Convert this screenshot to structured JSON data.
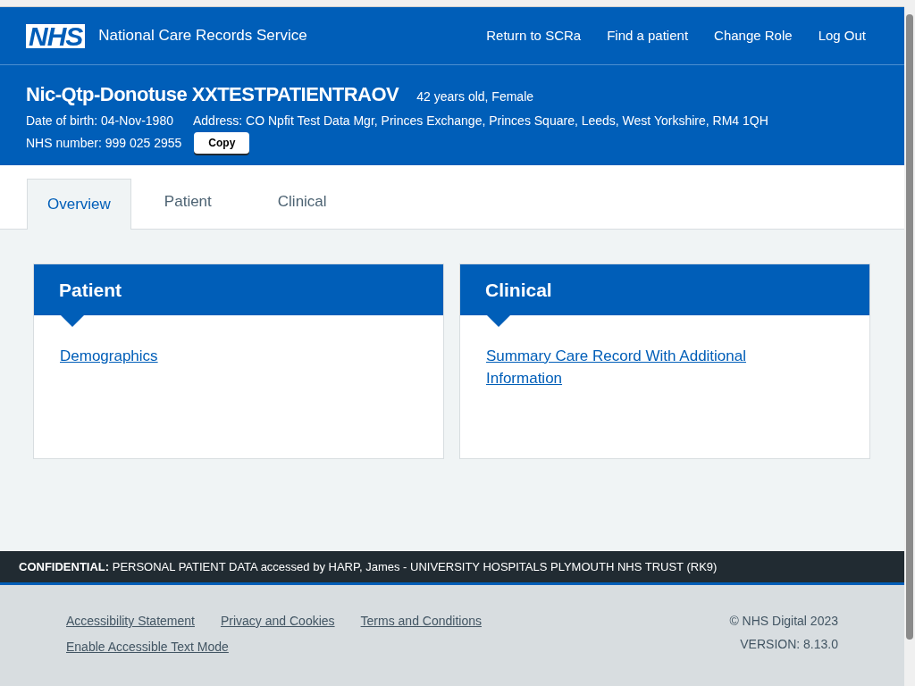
{
  "header": {
    "logo": "NHS",
    "service_name": "National Care Records Service",
    "nav_links": [
      "Return to SCRa",
      "Find a patient",
      "Change Role",
      "Log Out"
    ]
  },
  "patient_banner": {
    "name": "Nic-Qtp-Donotuse XXTESTPATIENTRAOV",
    "age_gender": "42 years old, Female",
    "date_of_birth": "Date of birth: 04-Nov-1980",
    "address": "Address: CO Npfit Test Data Mgr, Princes Exchange, Princes Square, Leeds, West Yorkshire, RM4 1QH",
    "nhs_number": "NHS number: 999 025 2955",
    "copy_button": "Copy"
  },
  "tabs": [
    {
      "label": "Overview",
      "selected": true
    },
    {
      "label": "Patient",
      "selected": false
    },
    {
      "label": "Clinical",
      "selected": false
    }
  ],
  "cards": [
    {
      "title": "Patient",
      "link": "Demographics"
    },
    {
      "title": "Clinical",
      "link": "Summary Care Record With Additional Information"
    }
  ],
  "confidential_bar": "**CONFIDENTIAL:** PERSONAL PATIENT DATA accessed by HARP, James - UNIVERSITY HOSPITALS PLYMOUTH NHS TRUST (RK9)",
  "footer": {
    "links": [
      "Accessibility Statement",
      "Privacy and Cookies",
      "Terms and Conditions",
      "Enable Accessible Text Mode"
    ],
    "copyright": "© NHS Digital 2023",
    "version": "VERSION: 8.13.0"
  }
}
